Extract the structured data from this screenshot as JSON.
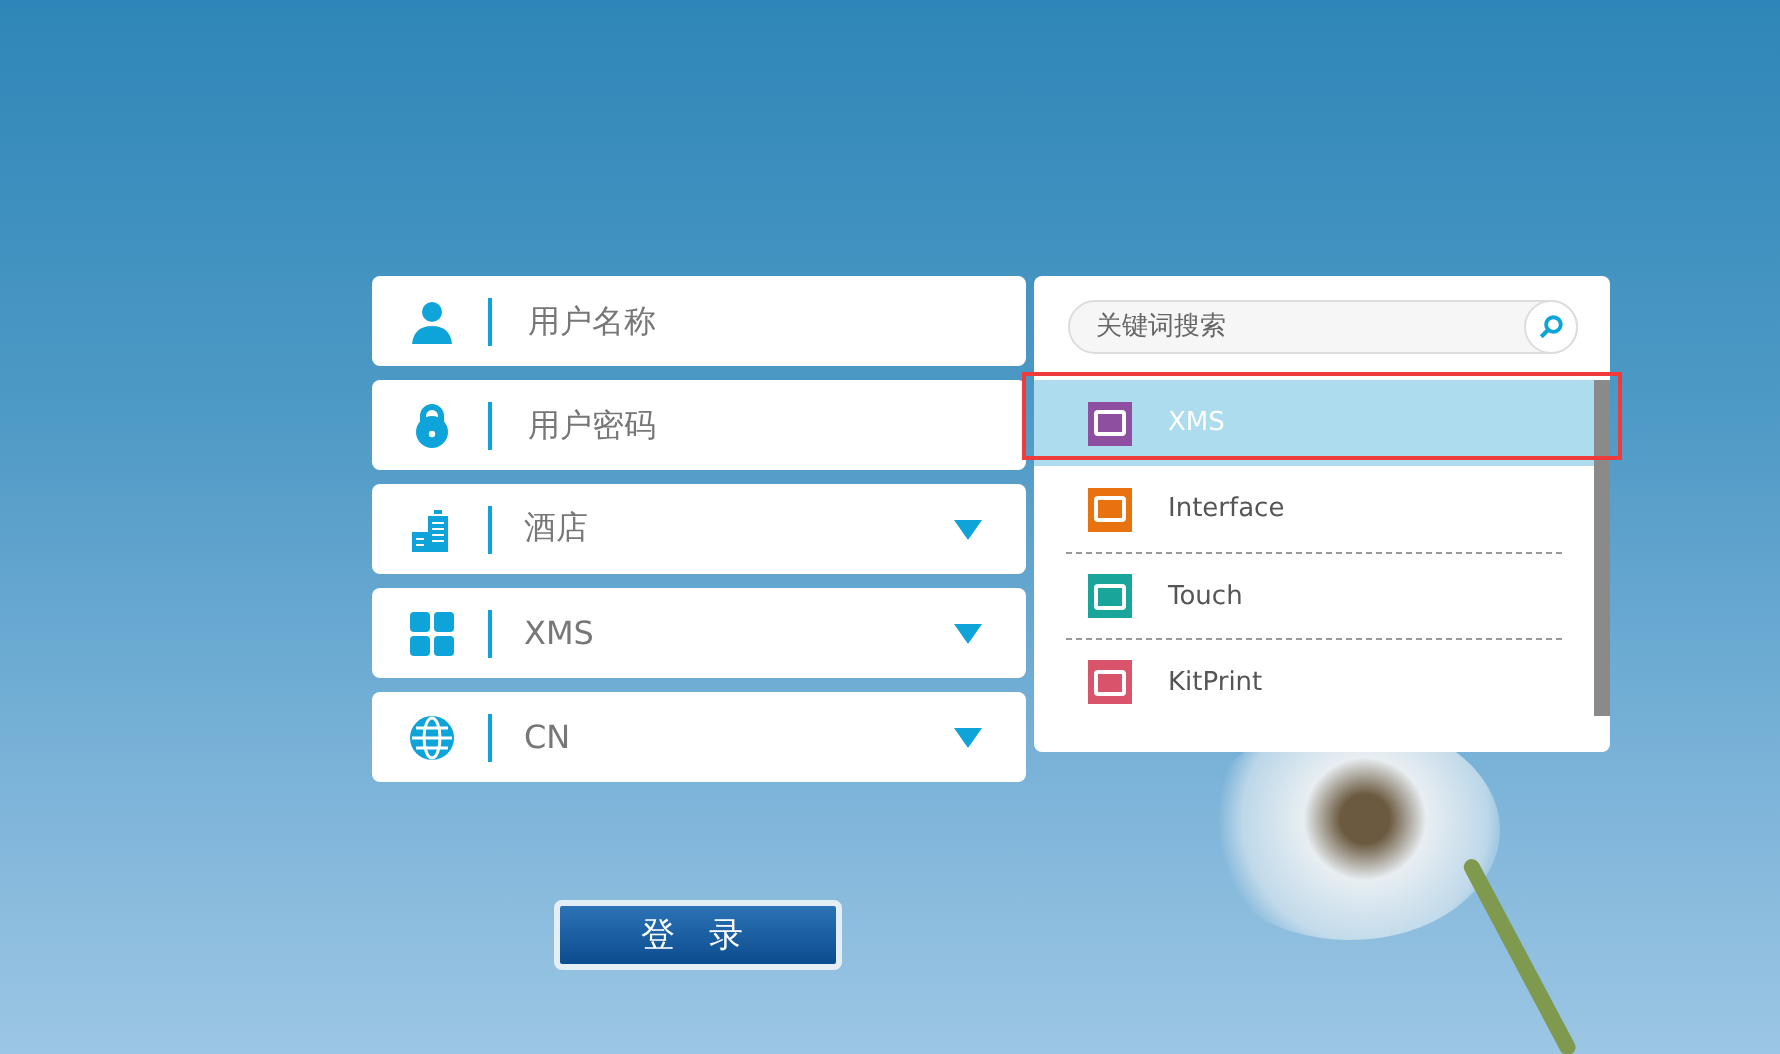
{
  "form_fields": [
    {
      "kind": "text",
      "placeholder": "用户名称"
    },
    {
      "kind": "text",
      "placeholder": "用户密码"
    },
    {
      "kind": "select",
      "value": "酒店"
    },
    {
      "kind": "select",
      "value": "XMS"
    },
    {
      "kind": "select",
      "value": "CN"
    }
  ],
  "dropdown": {
    "search": {
      "placeholder": "关键词搜索"
    },
    "items": [
      {
        "label": "XMS",
        "selected": true,
        "color": "#8e4fa0"
      },
      {
        "label": "Interface",
        "selected": false,
        "color": "#e8720f"
      },
      {
        "label": "Touch",
        "selected": false,
        "color": "#1aa59a"
      },
      {
        "label": "KitPrint",
        "selected": false,
        "color": "#d9546a"
      }
    ]
  },
  "login_button": {
    "label": "登 录"
  }
}
